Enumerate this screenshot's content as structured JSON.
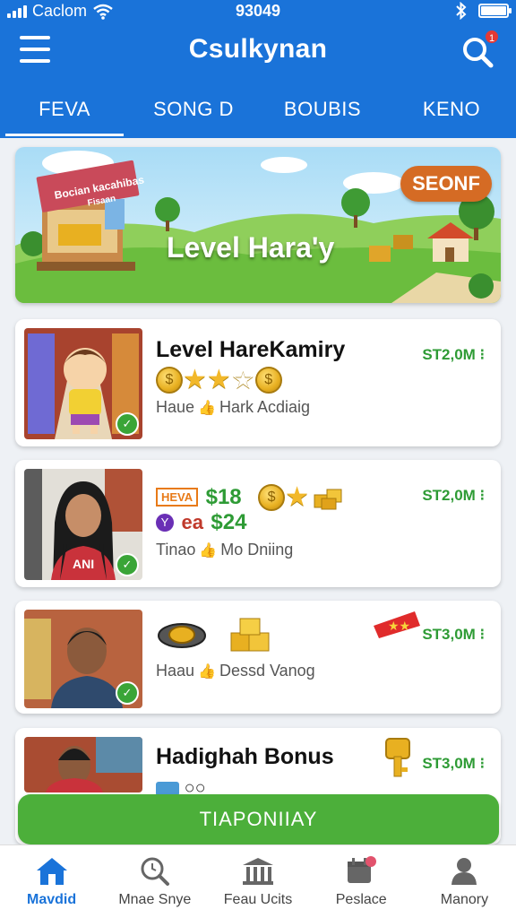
{
  "status_bar": {
    "carrier": "Caclom",
    "time": "93049"
  },
  "app_bar": {
    "title": "Csulkynan",
    "notification_count": "1"
  },
  "tabs": [
    {
      "label": "FEVA",
      "active": true
    },
    {
      "label": "SONG D",
      "active": false
    },
    {
      "label": "BOUBIS",
      "active": false
    },
    {
      "label": "KENO",
      "active": false
    }
  ],
  "banner": {
    "title": "Level Hara'y",
    "badge": "SEONF",
    "sign_text": "Bocian kacahibas",
    "sign_sub": "Fisaan"
  },
  "cards": [
    {
      "title": "Level HareKamiry",
      "price": "ST2,0M",
      "sub_left": "Haue",
      "sub_right": "Hark Acdiaig"
    },
    {
      "tag": "HEVA",
      "amount_1": "$18",
      "amount_2": "$24",
      "amount_2_prefix": "ea",
      "price": "ST2,0M",
      "sub_left": "Tinao",
      "sub_right": "Mo Dniing",
      "shirt_text": "ANI"
    },
    {
      "price": "ST3,0M",
      "sub_left": "Haau",
      "sub_right": "Dessd Vanog"
    },
    {
      "title": "Hadighah Bonus",
      "price": "ST3,0M"
    }
  ],
  "cta": {
    "label": "TIAPONIIAY"
  },
  "bottom_nav": [
    {
      "label": "Mavdid",
      "icon": "home-icon",
      "active": true
    },
    {
      "label": "Mnae Snye",
      "icon": "search-icon",
      "active": false
    },
    {
      "label": "Feau Ucits",
      "icon": "bank-icon",
      "active": false
    },
    {
      "label": "Peslace",
      "icon": "calendar-icon",
      "active": false
    },
    {
      "label": "Manory",
      "icon": "person-icon",
      "active": false
    }
  ],
  "colors": {
    "primary": "#1a73d9",
    "accent_green": "#4caf3a",
    "price_green": "#2e9b35",
    "badge_orange": "#d56b24"
  }
}
